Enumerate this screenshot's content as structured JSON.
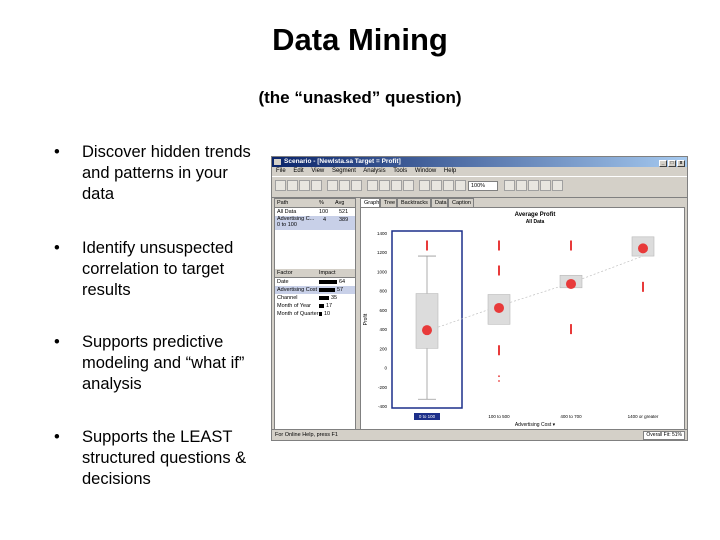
{
  "slide": {
    "title": "Data Mining",
    "subtitle": "(the “unasked” question)",
    "bullets": [
      {
        "marker": "•",
        "text": "Discover hidden trends and patterns in your data"
      },
      {
        "marker": "•",
        "text": "Identify unsuspected correlation to target results"
      },
      {
        "marker": "•",
        "text": "Supports predictive modeling and “what if” analysis"
      },
      {
        "marker": "•",
        "text": "Supports the LEAST structured questions & decisions"
      }
    ]
  },
  "app": {
    "window_title": "Scenario - [Newlsta.sa Target = Profit]",
    "window_buttons": [
      "_",
      "□",
      "x"
    ],
    "menu": [
      "File",
      "Edit",
      "View",
      "Segment",
      "Analysis",
      "Tools",
      "Window",
      "Help"
    ],
    "zoom": "100%",
    "path_table": {
      "headers": [
        "Path",
        "%",
        "Avg"
      ],
      "rows": [
        {
          "path": "All Data",
          "pct": "100",
          "avg": "521",
          "selected": false
        },
        {
          "path": "Advertising C... 0 to 100",
          "pct": "4",
          "avg": "389",
          "selected": true
        }
      ]
    },
    "factor_table": {
      "headers": [
        "Factor",
        "Impact"
      ],
      "rows": [
        {
          "factor": "Date",
          "impact": "64",
          "impact_frac": 0.64,
          "selected": false
        },
        {
          "factor": "Advertising Cost",
          "impact": "57",
          "impact_frac": 0.57,
          "selected": true
        },
        {
          "factor": "Channel",
          "impact": "35",
          "impact_frac": 0.35,
          "selected": false
        },
        {
          "factor": "Month of Year",
          "impact": "17",
          "impact_frac": 0.17,
          "selected": false
        },
        {
          "factor": "Month of Quarter",
          "impact": "10",
          "impact_frac": 0.1,
          "selected": false
        }
      ]
    },
    "tabs": [
      {
        "label": "Graph",
        "active": true
      },
      {
        "label": "Tree",
        "active": false
      },
      {
        "label": "Backtracks",
        "active": false
      },
      {
        "label": "Data",
        "active": false
      },
      {
        "label": "Caption",
        "active": false
      }
    ],
    "status": "For Online Help, press F1",
    "overall_fit": "Overall Fit: 51%",
    "colors": {
      "marker": "#e83a3a",
      "title_bar": "#0a246a",
      "panel": "#d4d0c8",
      "selection": "#1c2f8a"
    }
  },
  "chart_data": {
    "type": "box",
    "title": "Average Profit",
    "subtitle": "All Data",
    "ylabel": "Profit",
    "xlabel": "Advertising Cost",
    "ylim": [
      -400,
      1400
    ],
    "yticks": [
      -400,
      -200,
      0,
      200,
      400,
      600,
      800,
      1000,
      1200,
      1400
    ],
    "categories": [
      "0 to 100",
      "100 to 500",
      "400 to 700",
      "1400 or greater"
    ],
    "selected_category": "0 to 100",
    "mean": [
      389,
      620,
      870,
      1240
    ],
    "box_low": [
      200,
      450,
      830,
      1160
    ],
    "box_high": [
      770,
      760,
      960,
      1360
    ],
    "whisker_low": [
      -330,
      null,
      null,
      null
    ],
    "whisker_high": [
      1160,
      null,
      null,
      null
    ],
    "outlier_bars": [
      [
        1270
      ],
      [
        1270,
        1010,
        180
      ],
      [
        1270,
        400
      ],
      [
        840
      ]
    ],
    "outlier_dots": [
      [],
      [
        -90,
        -140
      ],
      [],
      []
    ],
    "trend": [
      380,
      640,
      880,
      1160
    ]
  }
}
